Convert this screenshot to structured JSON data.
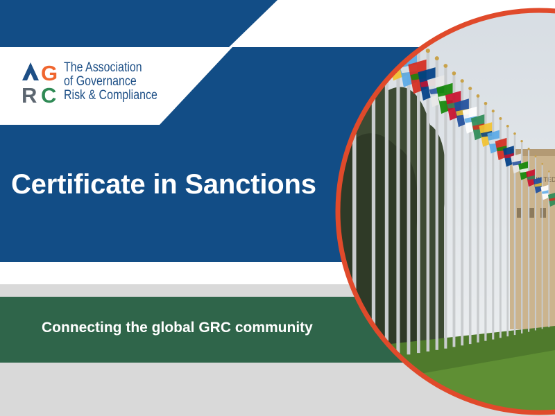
{
  "logo": {
    "letters": [
      "A",
      "G",
      "R",
      "C"
    ],
    "name_lines": [
      "The Association",
      "of Governance",
      "Risk & Compliance"
    ]
  },
  "title": "Certificate in Sanctions",
  "tagline": "Connecting the global GRC community",
  "photo_subject": "row-of-national-flags",
  "colors": {
    "navy": "#124d86",
    "green": "#2f654a",
    "grey": "#d9d9d9",
    "red_ring": "#e04a2b",
    "logo_orange": "#f0662f",
    "logo_green": "#2f8a55",
    "logo_grey": "#5c6670"
  }
}
